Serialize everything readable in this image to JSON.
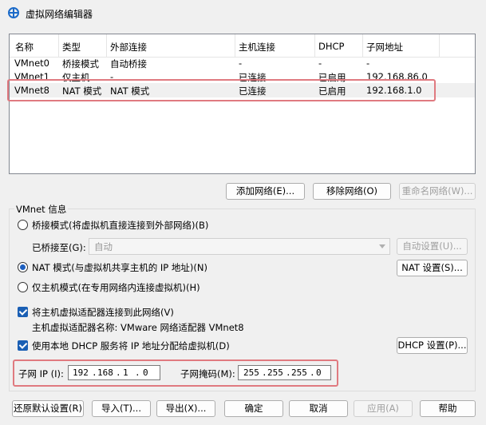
{
  "window": {
    "title": "虚拟网络编辑器"
  },
  "table": {
    "columns": [
      "名称",
      "类型",
      "外部连接",
      "主机连接",
      "DHCP",
      "子网地址"
    ],
    "rows": [
      {
        "name": "VMnet0",
        "type": "桥接模式",
        "external": "自动桥接",
        "host": "-",
        "dhcp": "-",
        "subnet": "-"
      },
      {
        "name": "VMnet1",
        "type": "仅主机...",
        "external": "-",
        "host": "已连接",
        "dhcp": "已启用",
        "subnet": "192.168.86.0"
      },
      {
        "name": "VMnet8",
        "type": "NAT 模式",
        "external": "NAT 模式",
        "host": "已连接",
        "dhcp": "已启用",
        "subnet": "192.168.1.0"
      }
    ]
  },
  "network_buttons": {
    "add": "添加网络(E)...",
    "remove": "移除网络(O)",
    "rename": "重命名网络(W)..."
  },
  "vmnet_info": {
    "title": "VMnet 信息",
    "bridge_mode": "桥接模式(将虚拟机直接连接到外部网络)(B)",
    "bridged_to_label": "已桥接至(G):",
    "bridged_to_value": "自动",
    "auto_settings": "自动设置(U)...",
    "nat_mode": "NAT 模式(与虚拟机共享主机的 IP 地址)(N)",
    "nat_settings": "NAT 设置(S)...",
    "host_only": "仅主机模式(在专用网络内连接虚拟机)(H)",
    "connect_adapter": "将主机虚拟适配器连接到此网络(V)",
    "adapter_name": "主机虚拟适配器名称: VMware 网络适配器 VMnet8",
    "use_dhcp": "使用本地 DHCP 服务将 IP 地址分配给虚拟机(D)",
    "dhcp_settings": "DHCP 设置(P)...",
    "subnet_ip_label": "子网 IP (I):",
    "subnet_ip": [
      "192",
      "168",
      "1",
      "0"
    ],
    "subnet_mask_label": "子网掩码(M):",
    "subnet_mask": [
      "255",
      "255",
      "255",
      "0"
    ]
  },
  "footer": {
    "restore": "还原默认设置(R)",
    "import": "导入(T)...",
    "export": "导出(X)...",
    "ok": "确定",
    "cancel": "取消",
    "apply": "应用(A)",
    "help": "帮助"
  },
  "colors": {
    "highlight": "#e07a80",
    "accent": "#1a5fb4"
  }
}
